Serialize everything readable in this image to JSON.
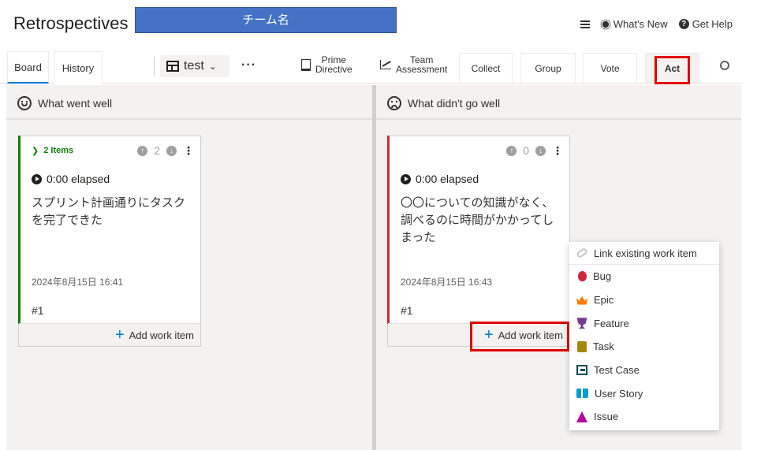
{
  "app": {
    "title": "Retrospectives",
    "team_name": "チーム名"
  },
  "header_links": {
    "menu_icon": "hamburger-icon",
    "whats_new": "What's New",
    "get_help": "Get Help"
  },
  "tabs": [
    {
      "label": "Board",
      "active": true
    },
    {
      "label": "History",
      "active": false
    }
  ],
  "board_selector": {
    "value": "test"
  },
  "toolbar": {
    "prime_directive": [
      "Prime",
      "Directive"
    ],
    "team_assessment": [
      "Team",
      "Assessment"
    ]
  },
  "stages": [
    {
      "label": "Collect"
    },
    {
      "label": "Group"
    },
    {
      "label": "Vote"
    },
    {
      "label": "Act",
      "active": true
    }
  ],
  "columns": [
    {
      "title": "What went well",
      "accent_color": "#107c10",
      "card": {
        "group_label": "2 Items",
        "upvotes": "2",
        "elapsed": "0:00 elapsed",
        "text": "スプリント計画通りにタスクを完了できた",
        "date": "2024年8月15日 16:41",
        "number": "#1",
        "add_work_item": "Add work item"
      }
    },
    {
      "title": "What didn't go well",
      "accent_color": "#cc293d",
      "card": {
        "group_label": "",
        "upvotes": "0",
        "elapsed": "0:00 elapsed",
        "text": "〇〇についての知識がなく、調べるのに時間がかかってしまった",
        "date": "2024年8月15日 16:43",
        "number": "#1",
        "add_work_item": "Add work item"
      }
    }
  ],
  "work_item_menu": {
    "link_existing": "Link existing work item",
    "items": [
      {
        "label": "Bug",
        "icon": "bug-icon",
        "color": "#cc293d"
      },
      {
        "label": "Epic",
        "icon": "crown-icon",
        "color": "#ff7b00"
      },
      {
        "label": "Feature",
        "icon": "trophy-icon",
        "color": "#773b93"
      },
      {
        "label": "Task",
        "icon": "clipboard-icon",
        "color": "#a4880a"
      },
      {
        "label": "Test Case",
        "icon": "test-case-icon",
        "color": "#004b50"
      },
      {
        "label": "User Story",
        "icon": "book-icon",
        "color": "#009ccc"
      },
      {
        "label": "Issue",
        "icon": "issue-icon",
        "color": "#b4009e"
      }
    ]
  }
}
